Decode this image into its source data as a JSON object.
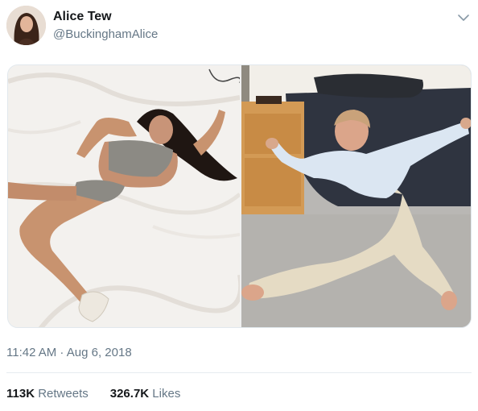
{
  "user": {
    "display_name": "Alice Tew",
    "handle": "@BuckinghamAlice"
  },
  "icons": {
    "menu": "chevron-down-icon"
  },
  "tweet": {
    "timestamp": "11:42 AM · Aug 6, 2018",
    "retweets_count": "113K",
    "retweets_label": "Retweets",
    "likes_count": "326.7K",
    "likes_label": "Likes"
  },
  "colors": {
    "text_primary": "#14171a",
    "text_secondary": "#657786",
    "divider": "#e6ecf0"
  }
}
